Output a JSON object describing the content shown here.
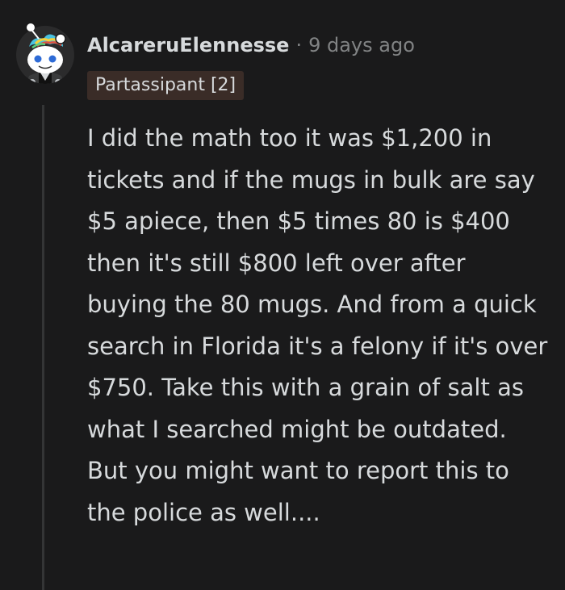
{
  "comment": {
    "author": "AlcareruElennesse",
    "separator": "·",
    "timestamp": "9 days ago",
    "flair": "Partassipant [2]",
    "body": "I did the math too it was $1,200 in tickets and if the mugs in bulk are say $5 apiece, then $5 times 80 is $400 then it's still $800 left over after buying the 80 mugs. And from a quick search in Florida it's a felony if it's over $750. Take this with a grain of salt as what I searched might be outdated. But you might want to report this to the police as well...."
  },
  "colors": {
    "background": "#1a1a1b",
    "text": "#d7dadc",
    "muted": "#818384",
    "flair_bg": "#3a2c27",
    "thread_line": "#343536"
  },
  "icons": {
    "avatar": "snoo-avatar-icon"
  }
}
